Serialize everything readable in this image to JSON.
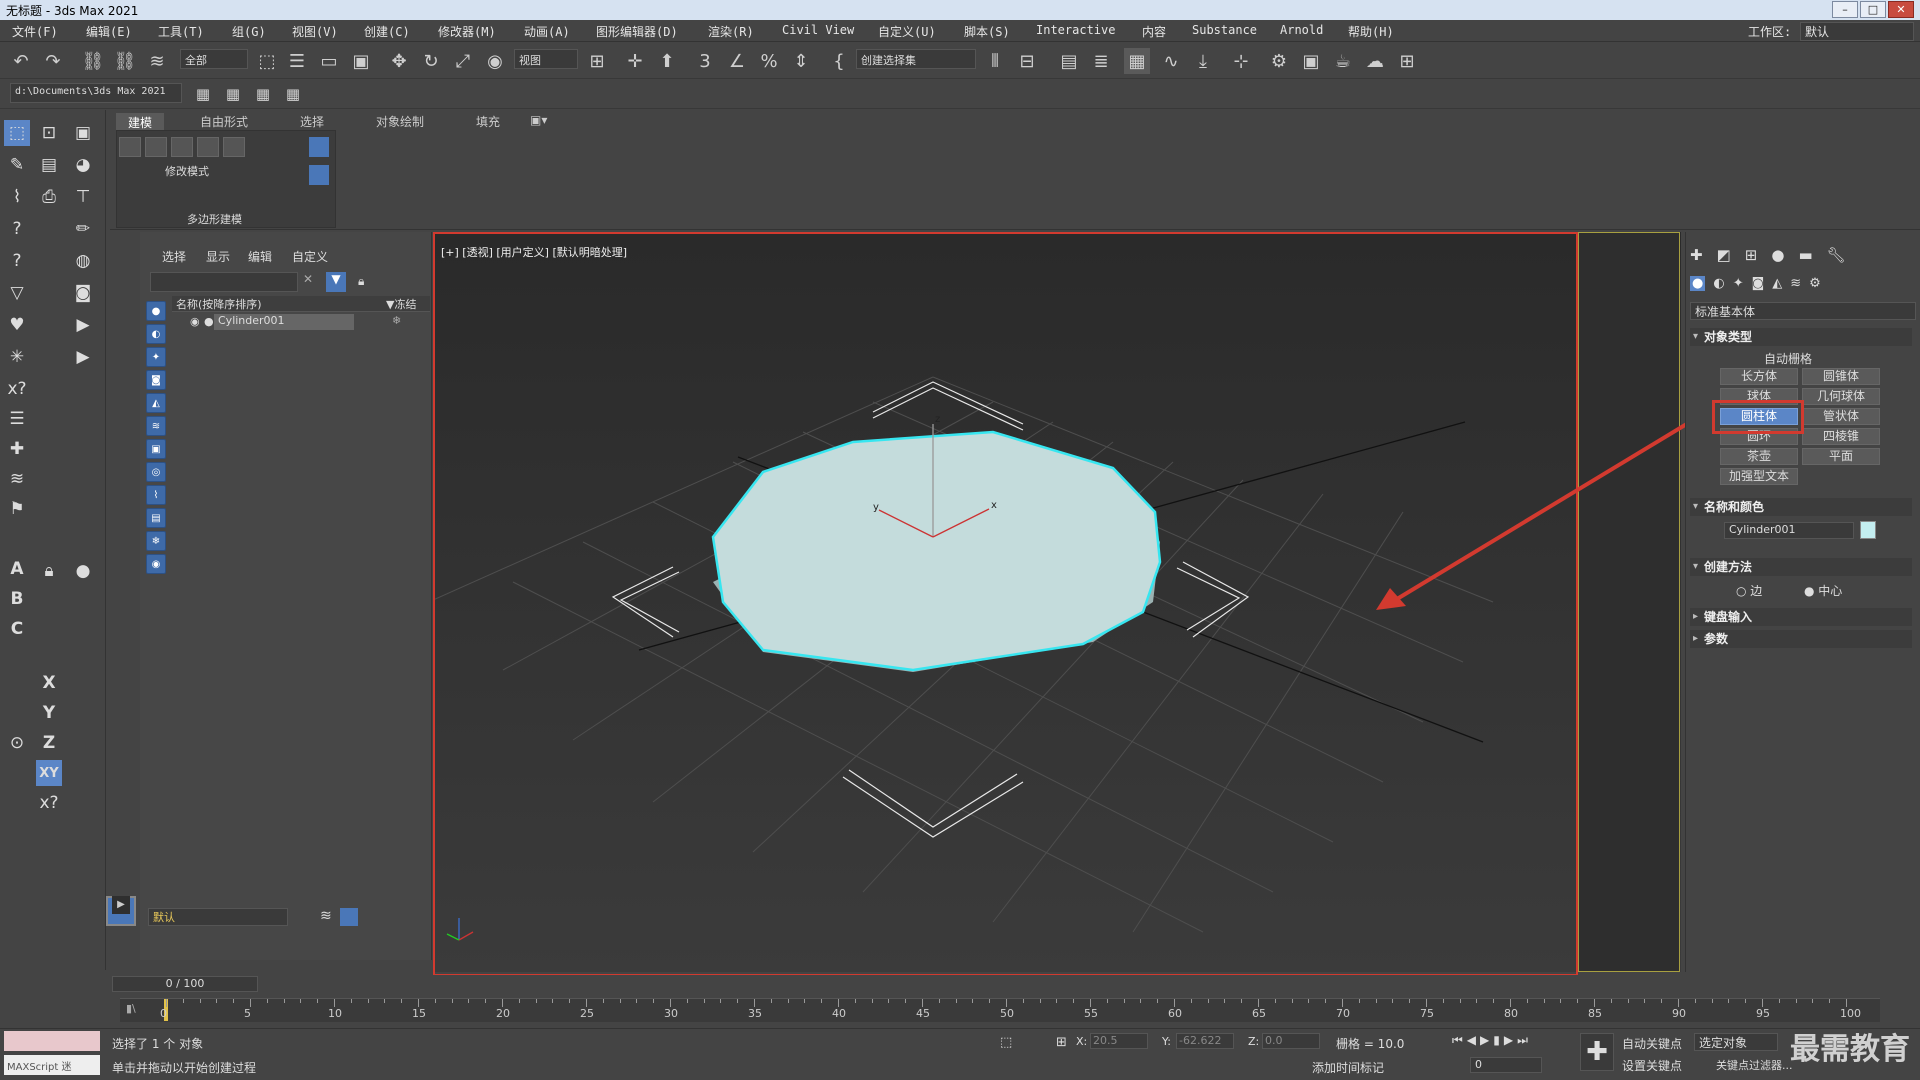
{
  "window": {
    "title": "无标题 - 3ds Max 2021"
  },
  "menu": [
    "文件(F)",
    "编辑(E)",
    "工具(T)",
    "组(G)",
    "视图(V)",
    "创建(C)",
    "修改器(M)",
    "动画(A)",
    "图形编辑器(D)",
    "渲染(R)",
    "Civil View",
    "自定义(U)",
    "脚本(S)",
    "Interactive",
    "内容",
    "Substance",
    "Arnold",
    "帮助(H)"
  ],
  "workspace": {
    "label": "工作区:",
    "value": "默认"
  },
  "toolbar": {
    "filter": "全部",
    "view": "视图",
    "selection_set": "创建选择集",
    "path": "d:\\Documents\\3ds Max 2021"
  },
  "ribbon": {
    "tabs": [
      "建模",
      "自由形式",
      "选择",
      "对象绘制",
      "填充"
    ],
    "panel_label": "修改模式",
    "footer": "多边形建模"
  },
  "scene_explorer": {
    "tabs": [
      "选择",
      "显示",
      "编辑",
      "自定义"
    ],
    "col_name": "名称(按降序排序)",
    "col_frozen": "▼冻结",
    "object": "Cylinder001",
    "layer": "默认"
  },
  "viewport": {
    "label": "[+] [透视] [用户定义] [默认明暗处理]",
    "axis_labels": [
      "z",
      "y",
      "x"
    ]
  },
  "command_panel": {
    "category": "标准基本体",
    "rollout_object_type": "对象类型",
    "autogrid": "自动栅格",
    "buttons": [
      "长方体",
      "圆锥体",
      "球体",
      "几何球体",
      "圆柱体",
      "管状体",
      "圆环",
      "四棱锥",
      "茶壶",
      "平面",
      "加强型文本"
    ],
    "selected_button": "圆柱体",
    "rollout_name_color": "名称和颜色",
    "name_value": "Cylinder001",
    "rollout_creation": "创建方法",
    "creation_options": [
      "边",
      "中心"
    ],
    "rollout_keyboard": "键盘输入",
    "rollout_params": "参数",
    "accent_color": "#5b86c7",
    "highlight_color": "#d23a2f"
  },
  "timeline": {
    "frame": "0 / 100",
    "ticks": [
      "0",
      "5",
      "10",
      "15",
      "20",
      "25",
      "30",
      "35",
      "40",
      "45",
      "50",
      "55",
      "60",
      "65",
      "70",
      "75",
      "80",
      "85",
      "90",
      "95",
      "100"
    ]
  },
  "status": {
    "maxscript": "MAXScript 迷",
    "line1": "选择了 1 个 对象",
    "line2": "单击并拖动以开始创建过程",
    "x_label": "X:",
    "x": "20.5",
    "y_label": "Y:",
    "y": "-62.622",
    "z_label": "Z:",
    "z": "0.0",
    "grid": "栅格 = 10.0",
    "add_marker": "添加时间标记",
    "auto_key": "自动关键点",
    "set_key": "设置关键点",
    "selected": "选定对象",
    "key_filter": "关键点过滤器...",
    "frame_field": "0"
  },
  "watermark": "最需教育"
}
